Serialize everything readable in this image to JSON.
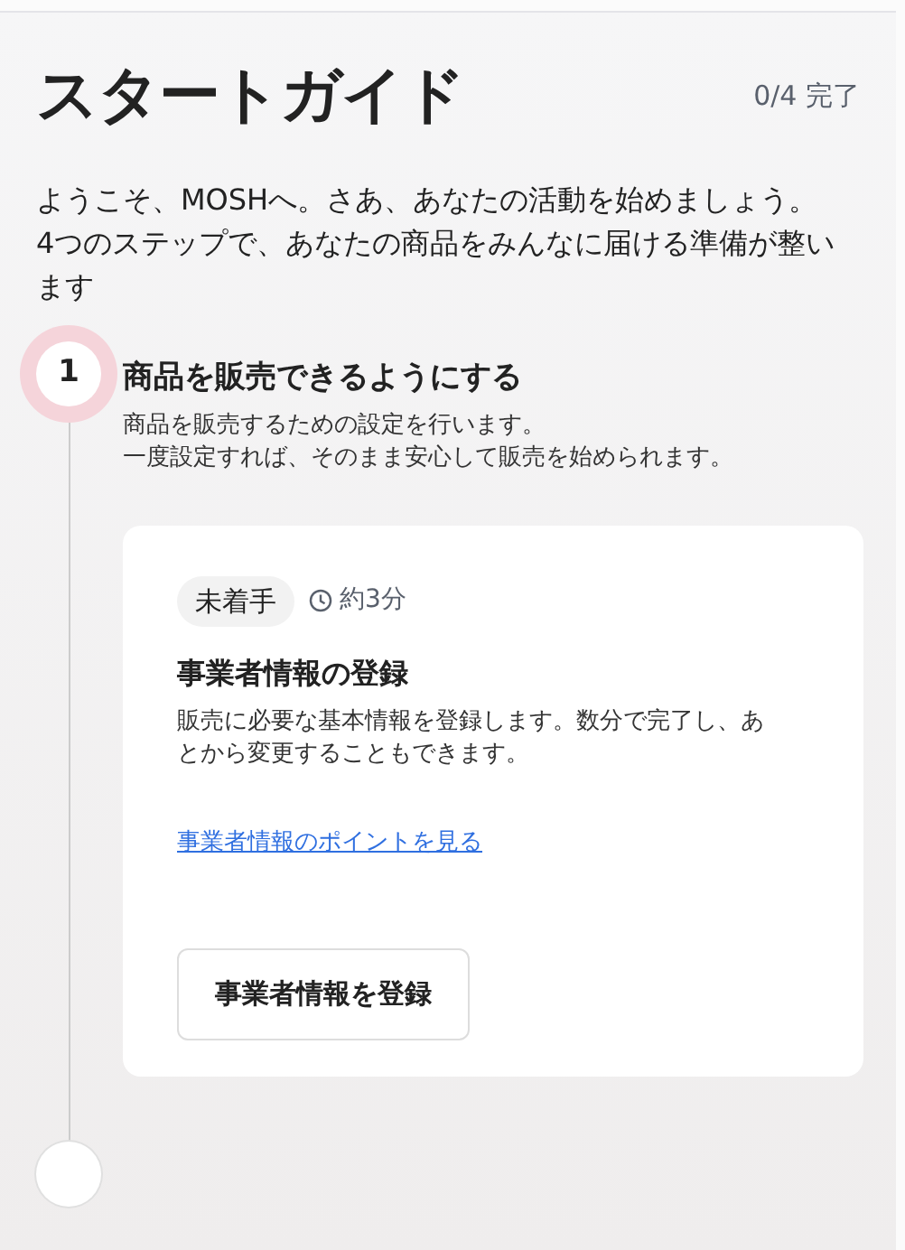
{
  "title": "スタートガイド",
  "progress": "0/4 完了",
  "intro": [
    "ようこそ、MOSHへ。さあ、あなたの活動を始めましょう。",
    "4つのステップで、あなたの商品をみんなに届ける準備が整います"
  ],
  "steps": [
    {
      "kind": "current",
      "number": "1",
      "title": "商品を販売できるようにする",
      "description": [
        "商品を販売するための設定を行います。",
        "一度設定すれば、そのまま安心して販売を始められます。"
      ],
      "tasks": [
        {
          "status": "未着手",
          "duration": "約3分",
          "title": "事業者情報の登録",
          "description": "販売に必要な基本情報を登録します。数分で完了し、あとから変更することもできます。",
          "link": "事業者情報のポイントを見る",
          "button": "事業者情報を登録"
        }
      ]
    },
    {
      "kind": "upcoming"
    }
  ]
}
